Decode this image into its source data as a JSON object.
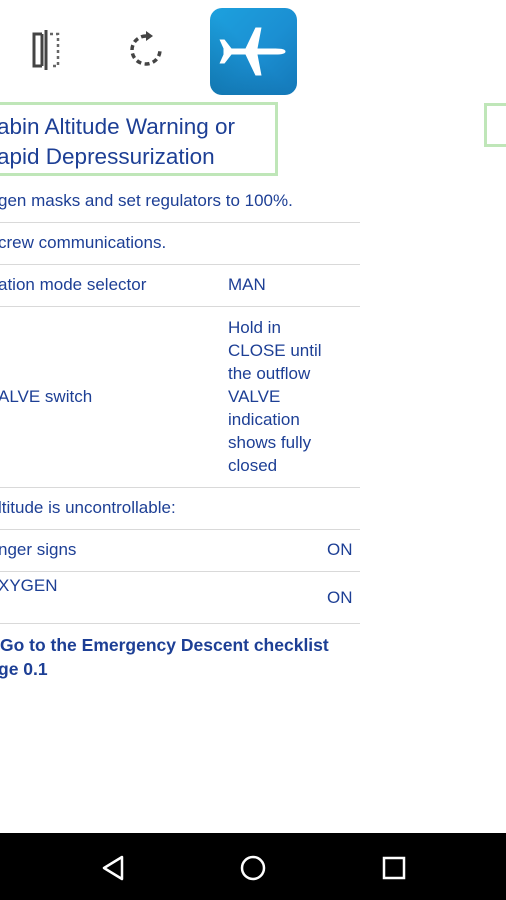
{
  "toolbar": {
    "icons": [
      "split-view-icon",
      "rotate-icon",
      "airplane-app-icon"
    ]
  },
  "checklist": {
    "title_line1": "abin Altitude Warning or",
    "title_line2": "apid Depressurization",
    "items": [
      {
        "text": "gen masks and set regulators to 100%."
      },
      {
        "text": "crew communications."
      },
      {
        "text": "ation mode selector",
        "value": "MAN"
      },
      {
        "text": "ALVE switch",
        "value": "Hold in CLOSE until the outflow VALVE indication shows fully closed"
      },
      {
        "text": "ltitude is uncontrollable:"
      },
      {
        "text": "nger signs",
        "value": "ON"
      },
      {
        "text": "XYGEN",
        "value": "ON"
      }
    ],
    "value_lines": [
      "Hold in",
      "CLOSE until",
      "the outflow",
      "VALVE",
      "indication",
      "shows fully",
      "closed"
    ],
    "link_line1": "Go to the Emergency Descent checklist",
    "link_line2": "ge 0.1"
  },
  "navbar": {
    "icons": [
      "back-icon",
      "home-icon",
      "recents-icon"
    ]
  },
  "colors": {
    "text": "#1d3f95",
    "title_border": "#bfe6b8",
    "app_icon": "#1b8fd2",
    "navbar": "#000000"
  }
}
